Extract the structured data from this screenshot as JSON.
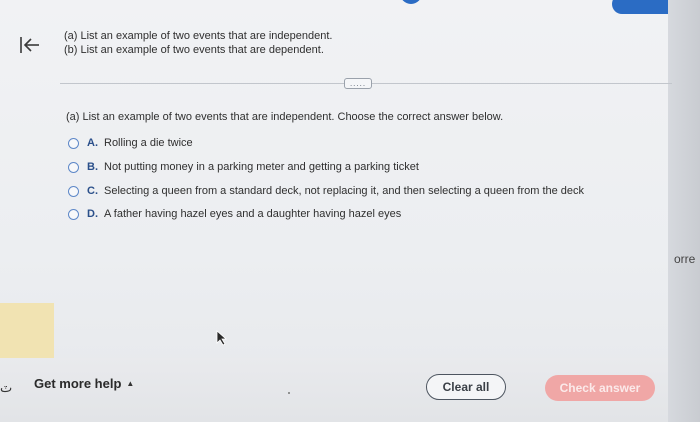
{
  "header": {
    "question_a": "(a) List an example of two events that are independent.",
    "question_b": "(b) List an example of two events that are dependent."
  },
  "divider": {
    "handle_label": "....."
  },
  "part_a": {
    "prompt": "(a) List an example of two events that are independent. Choose the correct answer below.",
    "options": [
      {
        "letter": "A.",
        "text": "Rolling a die twice"
      },
      {
        "letter": "B.",
        "text": "Not putting money in a parking meter and getting a parking ticket"
      },
      {
        "letter": "C.",
        "text": "Selecting a queen from a standard deck, not replacing it, and then selecting a queen from the deck"
      },
      {
        "letter": "D.",
        "text": "A father having hazel eyes and a daughter having hazel eyes"
      }
    ]
  },
  "footer": {
    "get_help_label": "Get more help",
    "clear_all_label": "Clear all",
    "check_answer_label": "Check answer"
  },
  "edge": {
    "right_partial_text": "orre"
  },
  "icons": {
    "back": "back-to-start-icon",
    "caret": "caret-up-icon"
  },
  "colors": {
    "accent_blue": "#2b6cc4",
    "check_answer_bg": "#f0a7a6",
    "radio_border": "#5e88c8"
  }
}
